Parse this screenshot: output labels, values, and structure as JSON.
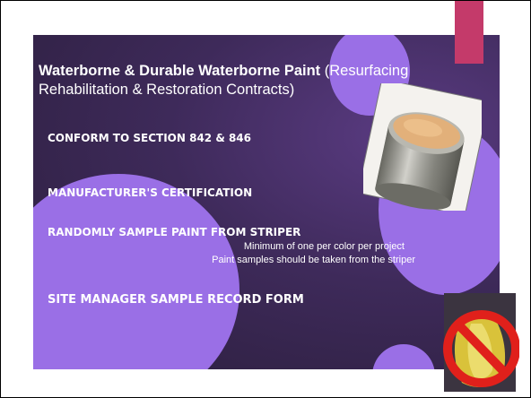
{
  "slide": {
    "title_bold": "Waterborne & Durable Waterborne Paint",
    "title_rest_1": " (Resurfacing",
    "title_rest_2": "Rehabilitation & Restoration Contracts)",
    "bullets": [
      "CONFORM TO SECTION 842 & 846",
      "MANUFACTURER'S CERTIFICATION",
      "RANDOMLY SAMPLE PAINT FROM STRIPER",
      "SITE MANAGER SAMPLE RECORD FORM"
    ],
    "subpoints": [
      "Minimum of one per color per project",
      "Paint samples should be taken from the striper"
    ]
  },
  "images": {
    "paint_can": "paint-can-photo",
    "prohibited_bag": "prohibited-bag-photo"
  },
  "colors": {
    "background": "#3e2a5a",
    "circle": "#9a6fe6",
    "accent": "#c43a6a",
    "prohibit": "#e0201b"
  }
}
